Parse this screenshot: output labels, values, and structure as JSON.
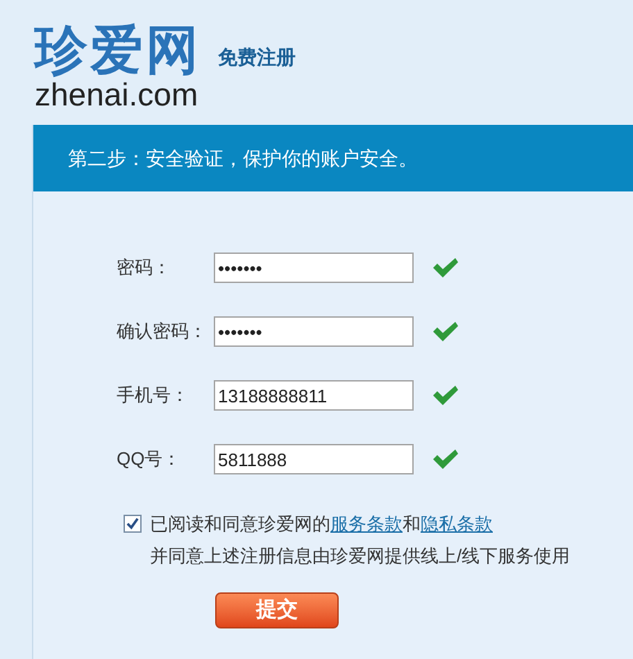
{
  "logo": {
    "title": "珍爱网",
    "domain": "zhenai.com"
  },
  "page_title": "免费注册",
  "step_banner": "第二步：安全验证，保护你的账户安全。",
  "fields": [
    {
      "label": "密码：",
      "value": "•••••••",
      "valid": true
    },
    {
      "label": "确认密码：",
      "value": "•••••••",
      "valid": true
    },
    {
      "label": "手机号：",
      "value": "13188888811",
      "valid": true
    },
    {
      "label": "QQ号：",
      "value": "5811888",
      "valid": true
    }
  ],
  "agreement": {
    "checked": true,
    "segments": [
      {
        "kind": "text",
        "text": "已阅读和同意珍爱网的"
      },
      {
        "kind": "link",
        "text": "服务条款"
      },
      {
        "kind": "text",
        "text": "和"
      },
      {
        "kind": "link",
        "text": "隐私条款"
      }
    ],
    "note": "并同意上述注册信息由珍爱网提供线上/线下服务使用"
  },
  "submit": "提交"
}
